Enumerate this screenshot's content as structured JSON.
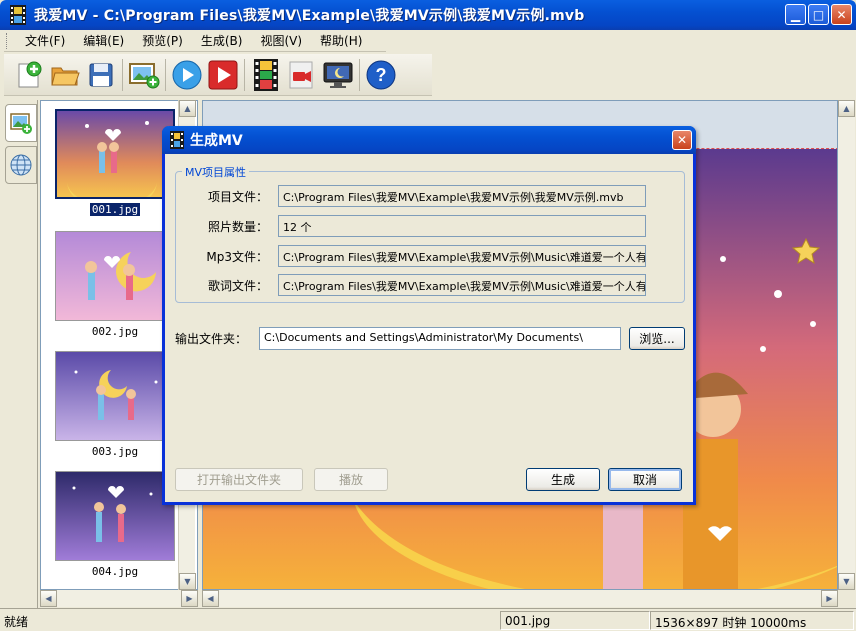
{
  "window": {
    "title": "我爱MV - C:\\Program Files\\我爱MV\\Example\\我爱MV示例\\我爱MV示例.mvb",
    "minimize": "▁",
    "maximize": "□",
    "close": "✕"
  },
  "menu": [
    "文件(F)",
    "编辑(E)",
    "预览(P)",
    "生成(B)",
    "视图(V)",
    "帮助(H)"
  ],
  "toolbar": {
    "icons": [
      "new-icon",
      "open-folder-icon",
      "save-icon",
      "add-photo-icon",
      "play-icon",
      "play-red-icon",
      "film-icon",
      "camera-icon",
      "monitor-icon",
      "help-icon"
    ]
  },
  "thumbnails": [
    {
      "name": "001.jpg",
      "selected": true
    },
    {
      "name": "002.jpg",
      "selected": false
    },
    {
      "name": "003.jpg",
      "selected": false
    },
    {
      "name": "004.jpg",
      "selected": false
    }
  ],
  "dialog": {
    "title": "生成MV",
    "close": "✕",
    "group_title": "MV项目属性",
    "fields": [
      {
        "label": "项目文件：",
        "value": "C:\\Program Files\\我爱MV\\Example\\我爱MV示例\\我爱MV示例.mvb"
      },
      {
        "label": "照片数量：",
        "value": "12 个"
      },
      {
        "label": "Mp3文件：",
        "value": "C:\\Program Files\\我爱MV\\Example\\我爱MV示例\\Music\\难道爱一个人有错吗"
      },
      {
        "label": "歌词文件：",
        "value": "C:\\Program Files\\我爱MV\\Example\\我爱MV示例\\Music\\难道爱一个人有错吗"
      }
    ],
    "output_label": "输出文件夹：",
    "output_value": "C:\\Documents and Settings\\Administrator\\My Documents\\",
    "browse": "浏览...",
    "open_folder": "打开输出文件夹",
    "play": "播放",
    "generate": "生成",
    "cancel": "取消"
  },
  "status": {
    "ready": "就绪",
    "file": "001.jpg",
    "info": "1536×897 时钟 10000ms"
  },
  "colors": {
    "titlebar": "#0450d1",
    "accent_red": "#e05050",
    "selection": "#0a246a"
  }
}
